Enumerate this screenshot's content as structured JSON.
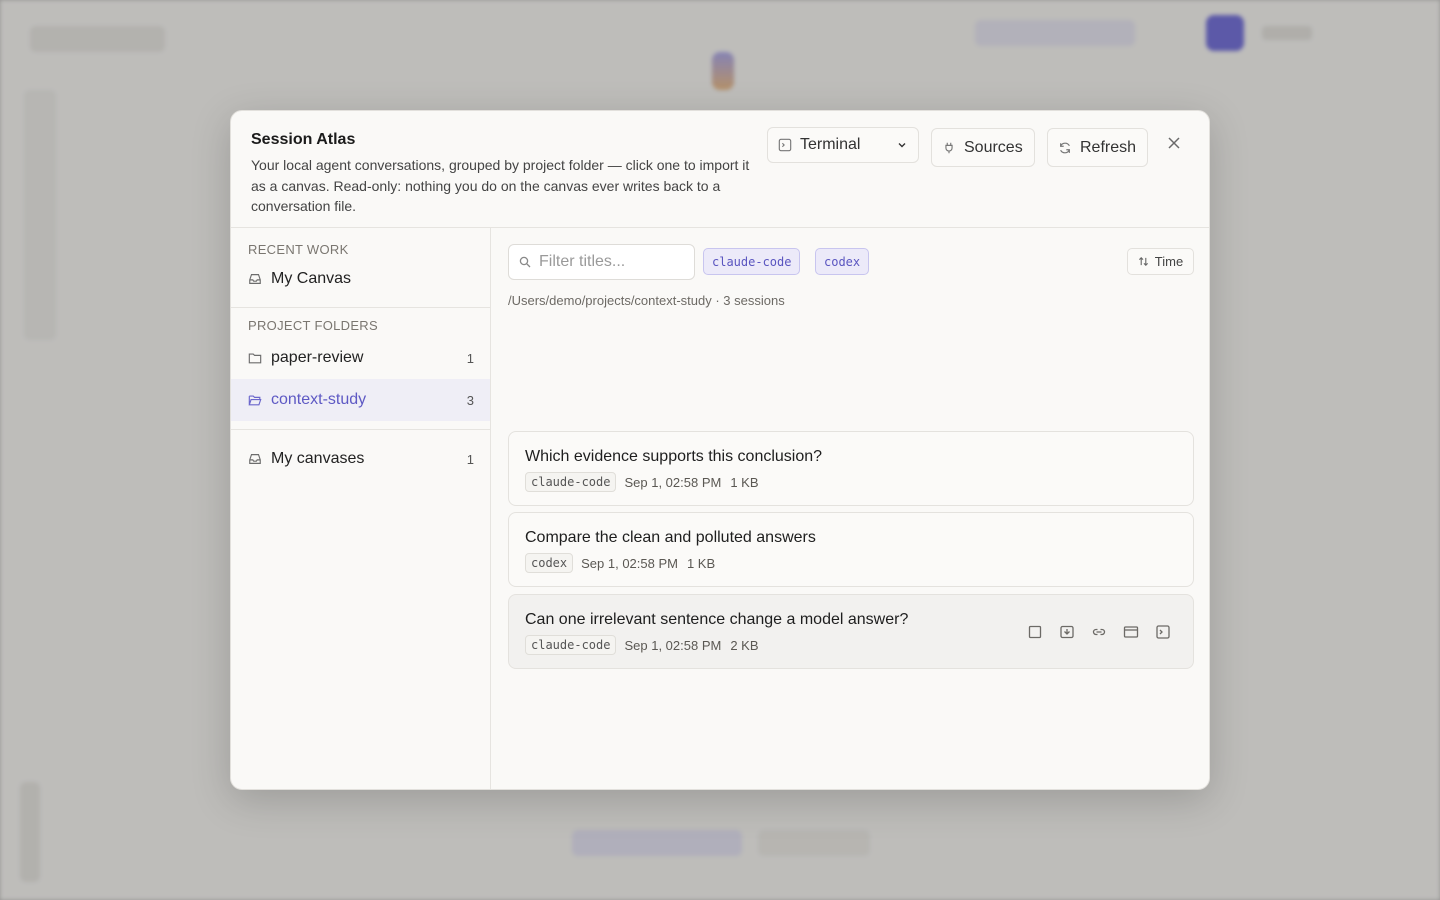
{
  "modal": {
    "title": "Session Atlas",
    "description": "Your local agent conversations, grouped by project folder — click one to import it as a canvas. Read-only: nothing you do on the canvas ever writes back to a conversation file.",
    "terminal_select": "Terminal",
    "sources_label": "Sources",
    "refresh_label": "Refresh"
  },
  "sidebar": {
    "recent_label": "RECENT WORK",
    "recent_item": "My Canvas",
    "folders_label": "PROJECT FOLDERS",
    "folders": [
      {
        "name": "paper-review",
        "count": "1"
      },
      {
        "name": "context-study",
        "count": "3"
      }
    ],
    "my_canvases": {
      "name": "My canvases",
      "count": "1"
    }
  },
  "main": {
    "filter_placeholder": "Filter titles...",
    "chips": [
      "claude-code",
      "codex"
    ],
    "sort_label": "Time",
    "path": "/Users/demo/projects/context-study · 3 sessions",
    "sessions": [
      {
        "title": "Which evidence supports this conclusion?",
        "source": "claude-code",
        "time": "Sep 1, 02:58 PM",
        "size": "1 KB"
      },
      {
        "title": "Compare the clean and polluted answers",
        "source": "codex",
        "time": "Sep 1, 02:58 PM",
        "size": "1 KB"
      },
      {
        "title": "Can one irrelevant sentence change a model answer?",
        "source": "claude-code",
        "time": "Sep 1, 02:58 PM",
        "size": "2 KB"
      }
    ]
  },
  "colors": {
    "accent": "#5e59c4",
    "active_bg": "#efeef6",
    "chip_bg": "#eceaf9"
  },
  "icons": [
    "terminal-icon",
    "plug-icon",
    "refresh-icon",
    "close-icon",
    "inbox-icon",
    "folder-icon",
    "folder-open-icon",
    "search-icon",
    "sort-icon",
    "square-icon",
    "import-icon",
    "link-icon",
    "window-icon"
  ]
}
